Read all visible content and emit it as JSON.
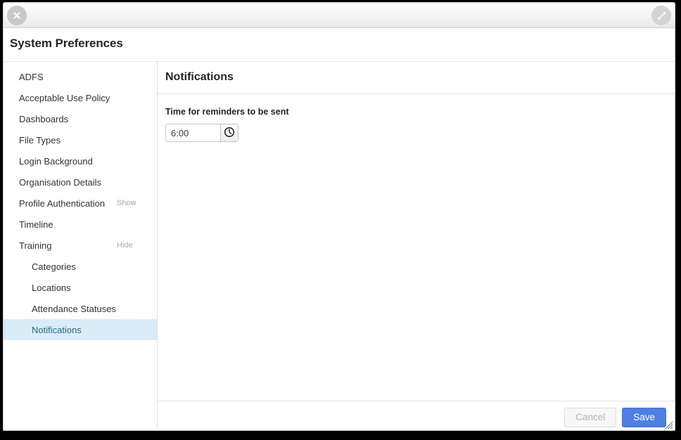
{
  "window": {
    "titlebar": {
      "close_icon": "close-icon",
      "expand_icon": "expand-diagonal-icon"
    },
    "header": {
      "title": "System Preferences"
    },
    "resize_grip": "resize-grip"
  },
  "sidebar": {
    "items": [
      {
        "label": "ADFS",
        "toggle": "",
        "level": 0,
        "selected": false
      },
      {
        "label": "Acceptable Use Policy",
        "toggle": "",
        "level": 0,
        "selected": false
      },
      {
        "label": "Dashboards",
        "toggle": "",
        "level": 0,
        "selected": false
      },
      {
        "label": "File Types",
        "toggle": "",
        "level": 0,
        "selected": false
      },
      {
        "label": "Login Background",
        "toggle": "",
        "level": 0,
        "selected": false
      },
      {
        "label": "Organisation Details",
        "toggle": "",
        "level": 0,
        "selected": false
      },
      {
        "label": "Profile Authentication",
        "toggle": "Show",
        "level": 0,
        "selected": false
      },
      {
        "label": "Timeline",
        "toggle": "",
        "level": 0,
        "selected": false
      },
      {
        "label": "Training",
        "toggle": "Hide",
        "level": 0,
        "selected": false
      },
      {
        "label": "Categories",
        "toggle": "",
        "level": 1,
        "selected": false
      },
      {
        "label": "Locations",
        "toggle": "",
        "level": 1,
        "selected": false
      },
      {
        "label": "Attendance Statuses",
        "toggle": "",
        "level": 1,
        "selected": false
      },
      {
        "label": "Notifications",
        "toggle": "",
        "level": 1,
        "selected": true
      }
    ]
  },
  "content": {
    "title": "Notifications",
    "field": {
      "label": "Time for reminders to be sent",
      "value": "6:00",
      "placeholder": "",
      "picker_icon": "clock-icon"
    }
  },
  "footer": {
    "cancel_label": "Cancel",
    "save_label": "Save"
  },
  "colors": {
    "accent": "#4e7fe1",
    "selected_row": "#d9ecf7",
    "selected_text": "#2b6a8a",
    "muted_text": "#a8a8a8"
  }
}
